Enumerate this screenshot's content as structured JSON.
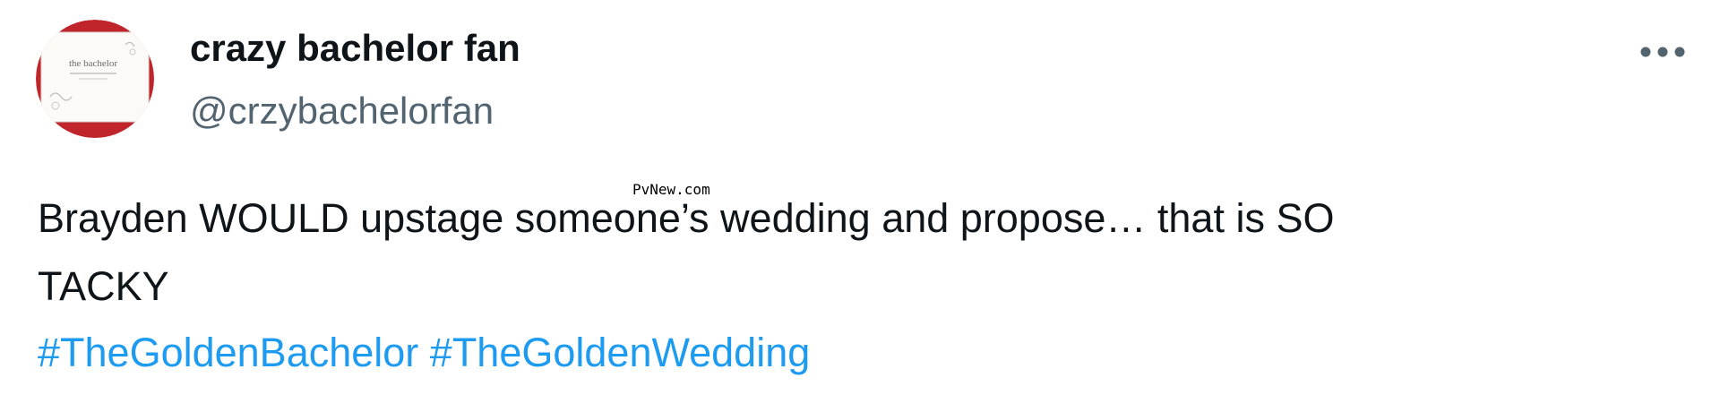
{
  "colors": {
    "text": "#0f1419",
    "secondary_text": "#536471",
    "link": "#1d9bf0",
    "avatar_border": "#c0252c"
  },
  "author": {
    "display_name": "crazy bachelor fan",
    "handle": "@crzybachelorfan",
    "avatar_text": "the bachelor"
  },
  "more_menu": {
    "icon": "more-horizontal-icon"
  },
  "tweet": {
    "text_lines": [
      "Brayden WOULD upstage someone’s wedding and propose… that is SO",
      "TACKY"
    ],
    "hashtags": [
      "#TheGoldenBachelor",
      "#TheGoldenWedding"
    ]
  },
  "watermark": "PvNew.com"
}
